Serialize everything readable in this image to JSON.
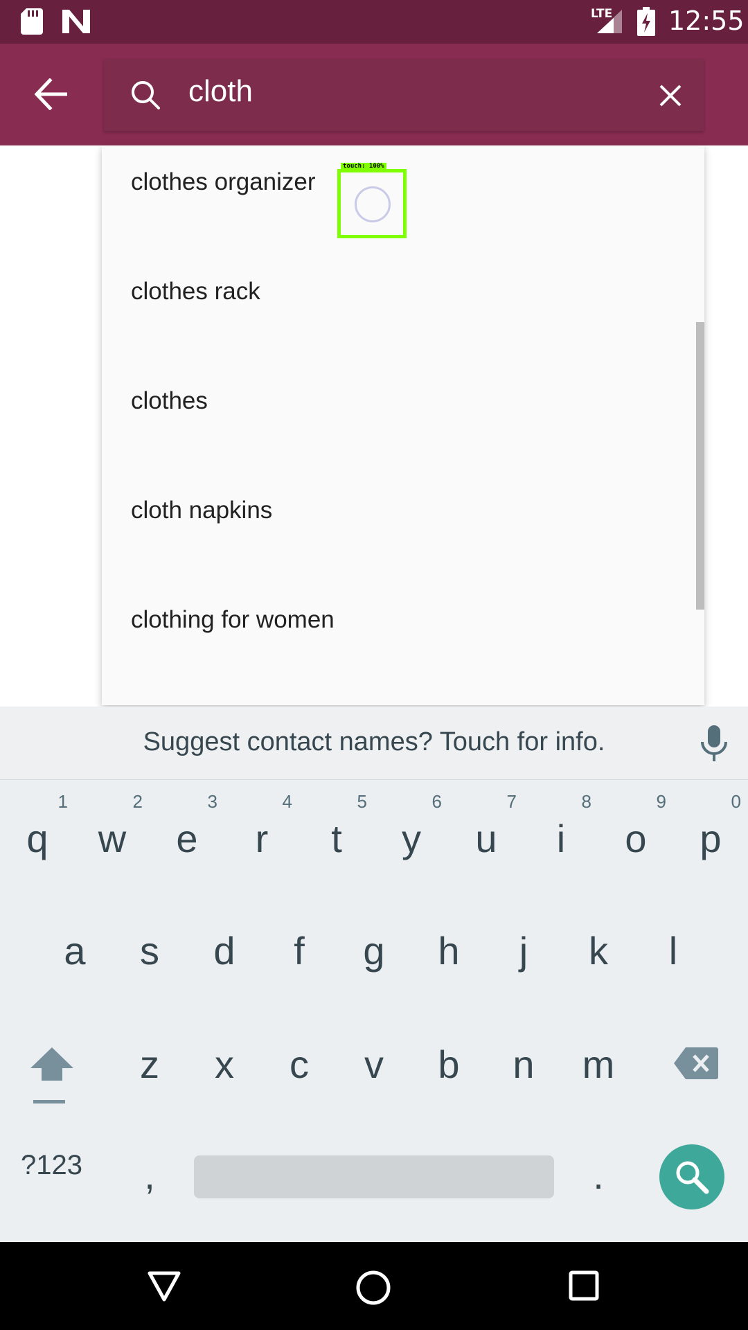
{
  "status_bar": {
    "time": "12:55",
    "network": "LTE",
    "icons": [
      "sd-card-icon",
      "n-icon",
      "signal-icon",
      "battery-charging-icon"
    ]
  },
  "search": {
    "query": "cloth",
    "back_icon": "arrow-back-icon",
    "search_icon": "search-icon",
    "clear_icon": "close-icon"
  },
  "suggestions": [
    {
      "label": "clothes organizer"
    },
    {
      "label": "clothes rack"
    },
    {
      "label": "clothes"
    },
    {
      "label": "cloth napkins"
    },
    {
      "label": "clothing for women"
    }
  ],
  "touch_overlay": {
    "label": "touch: 100%"
  },
  "keyboard": {
    "suggestion_strip": "Suggest contact names? Touch for info.",
    "row1": [
      {
        "key": "q",
        "hint": "1"
      },
      {
        "key": "w",
        "hint": "2"
      },
      {
        "key": "e",
        "hint": "3"
      },
      {
        "key": "r",
        "hint": "4"
      },
      {
        "key": "t",
        "hint": "5"
      },
      {
        "key": "y",
        "hint": "6"
      },
      {
        "key": "u",
        "hint": "7"
      },
      {
        "key": "i",
        "hint": "8"
      },
      {
        "key": "o",
        "hint": "9"
      },
      {
        "key": "p",
        "hint": "0"
      }
    ],
    "row2": [
      "a",
      "s",
      "d",
      "f",
      "g",
      "h",
      "j",
      "k",
      "l"
    ],
    "row3": [
      "z",
      "x",
      "c",
      "v",
      "b",
      "n",
      "m"
    ],
    "symbols_label": "?123",
    "comma": ",",
    "period": ".",
    "accent_color": "#3ea89a"
  },
  "colors": {
    "status_bar": "#67203d",
    "app_bar": "#892c52"
  }
}
